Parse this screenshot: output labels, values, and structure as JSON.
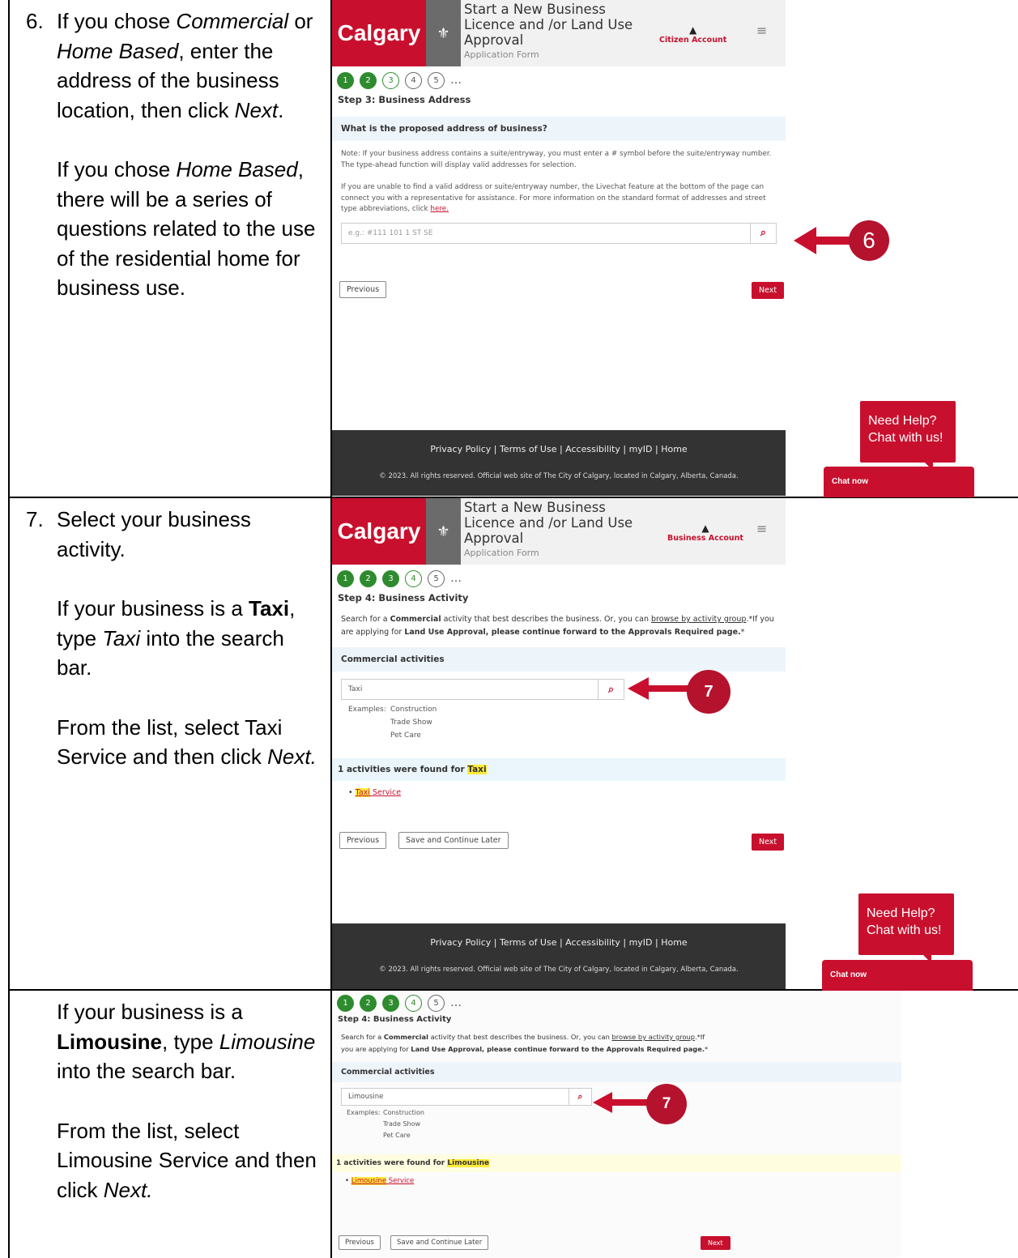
{
  "rows": [
    {
      "step_number": "6.",
      "para1": {
        "a": "If you chose ",
        "b": "Commercial",
        "c": " or ",
        "d": "Home Based",
        "e": ", enter the address of the business location, then click ",
        "f": "Next",
        "g": "."
      },
      "para2": {
        "a": "If you chose ",
        "b": "Home Based",
        "c": ", there will be a series of questions related to the use of the residential home for business use."
      },
      "screenshot": {
        "logo": "Calgary",
        "title": "Start a New Business Licence and /or Land Use Approval",
        "subtitle": "Application Form",
        "account": "Citizen Account",
        "steps": [
          "1",
          "2",
          "3",
          "4",
          "5",
          "…"
        ],
        "step_heading": "Step 3: Business Address",
        "question": "What is the proposed address of business?",
        "note1": "Note: If your business address contains a suite/entryway, you must enter a # symbol before the suite/entryway number. The type-ahead function will display valid addresses for selection.",
        "note2": "If you are unable to find a valid address or suite/entryway number, the Livechat feature at the bottom of the page can connect you with a representative for assistance. For more information on the standard format of addresses and street type abbreviations, click ",
        "note2_link": "here.",
        "search_placeholder": "e.g.: #111 101 1 ST SE",
        "prev_label": "Previous",
        "next_label": "Next",
        "footer_links": "Privacy Policy  |  Terms of Use  |  Accessibility  |  myID  |  Home",
        "footer_copy": "© 2023. All rights reserved. Official web site of The City of Calgary, located in Calgary, Alberta, Canada.",
        "chat_bubble": "Need Help? Chat with us!",
        "chat_now": "Chat now",
        "callout": "6"
      }
    },
    {
      "step_number": "7.",
      "para1": "Select your business activity.",
      "para2": {
        "a": "If your business is a ",
        "b": "Taxi",
        "c": ", type ",
        "d": "Taxi",
        "e": " into the search bar."
      },
      "para3": {
        "a": "From the list, select Taxi Service and then click ",
        "b": "Next."
      },
      "screenshot": {
        "logo": "Calgary",
        "title": "Start a New Business Licence and /or Land Use Approval",
        "subtitle": "Application Form",
        "account": "Business Account",
        "steps": [
          "1",
          "2",
          "3",
          "4",
          "5",
          "…"
        ],
        "step_heading": "Step 4: Business Activity",
        "desc_a": "Search for a ",
        "desc_b": "Commercial",
        "desc_c": " activity that best describes the business. Or, you can ",
        "desc_link": "browse by activity group",
        "desc_d": ".*If you are applying for ",
        "desc_e": "Land Use Approval, please continue forward to the Approvals Required page.",
        "desc_f": "*",
        "section": "Commercial activities",
        "search_value": "Taxi",
        "examples_label": "Examples:",
        "examples": [
          "Construction",
          "Trade Show",
          "Pet Care"
        ],
        "results_a": "1 activities were found for ",
        "results_term": "Taxi",
        "result_hl": "Taxi",
        "result_rest": " Service",
        "prev_label": "Previous",
        "save_label": "Save and Continue Later",
        "next_label": "Next",
        "footer_links": "Privacy Policy  |  Terms of Use  |  Accessibility  |  myID  |  Home",
        "footer_copy": "© 2023. All rights reserved. Official web site of The City of Calgary, located in Calgary, Alberta, Canada.",
        "chat_bubble": "Need Help? Chat with us!",
        "chat_now": "Chat now",
        "callout": "7"
      }
    },
    {
      "para1": {
        "a": "If your business is a ",
        "b": "Limousine",
        "c": ", type ",
        "d": "Limousine",
        "e": " into the search bar."
      },
      "para2": {
        "a": "From the list, select Limousine Service and then click ",
        "b": "Next."
      },
      "screenshot": {
        "steps": [
          "1",
          "2",
          "3",
          "4",
          "5",
          "…"
        ],
        "step_heading": "Step 4: Business Activity",
        "desc_a": "Search for a ",
        "desc_b": "Commercial",
        "desc_c": " activity that best describes the business. Or, you can ",
        "desc_link": "browse by activity group",
        "desc_d": ".*If you are applying for ",
        "desc_e": "Land Use Approval, please continue forward to the Approvals Required page.",
        "desc_f": "*",
        "section": "Commercial activities",
        "search_value": "Limousine",
        "examples_label": "Examples:",
        "examples": [
          "Construction",
          "Trade Show",
          "Pet Care"
        ],
        "results_a": "1 activities were found for ",
        "results_term": "Limousine",
        "result_hl": "Limousine",
        "result_rest": " Service",
        "prev_label": "Previous",
        "save_label": "Save and Continue Later",
        "next_label": "Next",
        "callout": "7"
      }
    }
  ],
  "colors": {
    "brand_red": "#c8102e",
    "step_green": "#2e8b2e",
    "callout_red": "#b5122d",
    "footer_dark": "#333333"
  }
}
